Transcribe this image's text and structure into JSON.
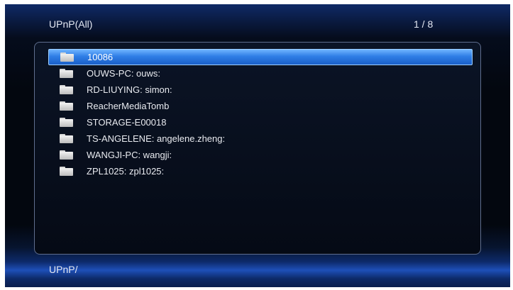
{
  "header": {
    "title": "UPnP(All)",
    "page_counter": "1 / 8"
  },
  "list": {
    "selected_index": 0,
    "items": [
      {
        "label": "10086",
        "icon": "folder-icon"
      },
      {
        "label": "OUWS-PC: ouws:",
        "icon": "folder-icon"
      },
      {
        "label": "RD-LIUYING: simon:",
        "icon": "folder-icon"
      },
      {
        "label": "ReacherMediaTomb",
        "icon": "folder-icon"
      },
      {
        "label": "STORAGE-E00018",
        "icon": "folder-icon"
      },
      {
        "label": "TS-ANGELENE: angelene.zheng:",
        "icon": "folder-icon"
      },
      {
        "label": "WANGJI-PC: wangji:",
        "icon": "folder-icon"
      },
      {
        "label": "ZPL1025: zpl1025:",
        "icon": "folder-icon"
      }
    ]
  },
  "footer": {
    "path": "UPnP/"
  },
  "colors": {
    "selection": "#2f7ee6",
    "background": "#03070f",
    "accent_glow": "#1e4fb8",
    "text": "#e9ebf0"
  }
}
